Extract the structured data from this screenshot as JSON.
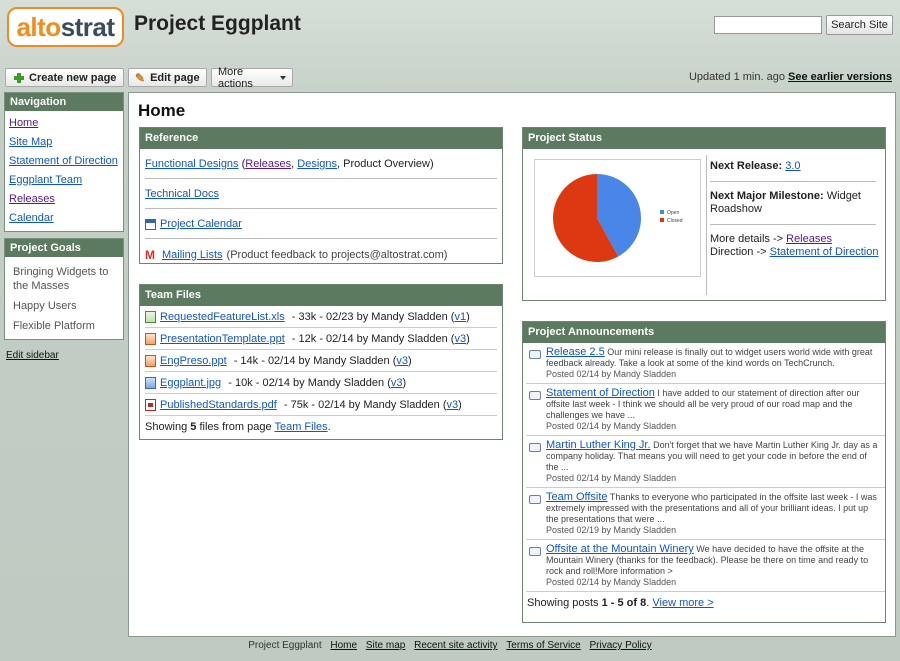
{
  "header": {
    "logo": {
      "part1": "alto",
      "part2": "strat"
    },
    "site_title": "Project Eggplant",
    "search_placeholder": "",
    "search_button": "Search Site"
  },
  "toolbar": {
    "create_page": "Create new page",
    "edit_page": "Edit page",
    "more_actions": "More actions",
    "updated_text": "Updated 1 min. ago",
    "earlier_versions": "See earlier versions"
  },
  "sidebar": {
    "navigation_title": "Navigation",
    "nav_items": [
      {
        "label": "Home",
        "visited": true
      },
      {
        "label": "Site Map",
        "visited": false
      },
      {
        "label": "Statement of Direction",
        "visited": false
      },
      {
        "label": "Eggplant Team",
        "visited": false
      },
      {
        "label": "Releases",
        "visited": true
      },
      {
        "label": "Calendar",
        "visited": false
      }
    ],
    "goals_title": "Project Goals",
    "goals": [
      "Bringing Widgets to the Masses",
      "Happy Users",
      "Flexible Platform"
    ],
    "edit_sidebar": "Edit sidebar"
  },
  "main": {
    "page_title": "Home",
    "reference": {
      "title": "Reference",
      "functional_designs": "Functional Designs",
      "open_paren": " (",
      "releases": "Releases",
      "comma1": ", ",
      "designs": "Designs",
      "rest": ", Product Overview)",
      "technical_docs": "Technical Docs",
      "project_calendar": "Project Calendar",
      "mailing_lists": "Mailing Lists",
      "mailing_note": "(Product feedback to projects@altostrat.com)"
    },
    "team_files": {
      "title": "Team Files",
      "files": [
        {
          "name": "RequestedFeatureList.xls",
          "meta": " - 33k - 02/23 by Mandy Sladden (",
          "version": "v1",
          "type": "xls"
        },
        {
          "name": "PresentationTemplate.ppt",
          "meta": " - 12k - 02/14 by Mandy Sladden (",
          "version": "v3",
          "type": "ppt"
        },
        {
          "name": "EngPreso.ppt",
          "meta": " - 14k - 02/14 by Mandy Sladden (",
          "version": "v3",
          "type": "ppt"
        },
        {
          "name": "Eggplant.jpg",
          "meta": " - 10k - 02/14 by Mandy Sladden (",
          "version": "v3",
          "type": "jpg"
        },
        {
          "name": "PublishedStandards.pdf",
          "meta": " - 75k - 02/14 by Mandy Sladden (",
          "version": "v3",
          "type": "pdf"
        }
      ],
      "summary_prefix": "Showing ",
      "summary_count": "5",
      "summary_mid": " files from page ",
      "summary_link": "Team Files",
      "summary_end": "."
    },
    "project_status": {
      "title": "Project Status",
      "next_release_label": "Next Release:",
      "next_release_value": "3.0",
      "milestone_label": "Next Major Milestone:",
      "milestone_value": "Widget Roadshow",
      "details_text": "More details ->",
      "details_link": "Releases",
      "direction_text": "Direction ->",
      "direction_link": "Statement of Direction"
    },
    "announcements": {
      "title": "Project Announcements",
      "items": [
        {
          "title": "Release 2.5",
          "body": "Our mini release is finally out to widget users world wide with great feedback already. Take a look at some of the kind words on TechCrunch.",
          "meta": "Posted 02/14 by Mandy Sladden"
        },
        {
          "title": "Statement of Direction",
          "body": "I have added to our statement of direction after our offsite last week - I think we should all be very proud of our road map and the challenges we have ...",
          "meta": "Posted 02/14 by Mandy Sladden"
        },
        {
          "title": "Martin Luther King Jr.",
          "body": "Don't forget that we have Martin Luther King Jr. day as a company holiday. That means you will need to get your code in before the end of the ...",
          "meta": "Posted 02/14 by Mandy Sladden"
        },
        {
          "title": "Team Offsite",
          "body": "Thanks to everyone who participated in the offsite last week - I was extremely impressed with the presentations and all of your brilliant ideas. I put up the presentations that were ...",
          "meta": "Posted 02/19 by Mandy Sladden"
        },
        {
          "title": "Offsite at the Mountain Winery",
          "body": "We have decided to have the offsite at the Mountain Winery (thanks for the feedback). Please be there on time and ready to rock and roll!More information >",
          "meta": "Posted 02/14 by Mandy Sladden"
        }
      ],
      "summary_prefix": "Showing posts ",
      "summary_range": "1 - 5",
      "summary_of": " of ",
      "summary_total": "8",
      "summary_end": ".",
      "view_more": "View more >"
    }
  },
  "chart_data": {
    "type": "pie",
    "categories": [
      "Open",
      "Closed"
    ],
    "values": [
      42,
      58
    ],
    "colors": [
      "#4a86e8",
      "#dc3912"
    ],
    "legend_position": "right"
  },
  "footer": {
    "site_name": "Project Eggplant",
    "links": [
      "Home",
      "Site map",
      "Recent site activity",
      "Terms of Service",
      "Privacy Policy"
    ]
  }
}
